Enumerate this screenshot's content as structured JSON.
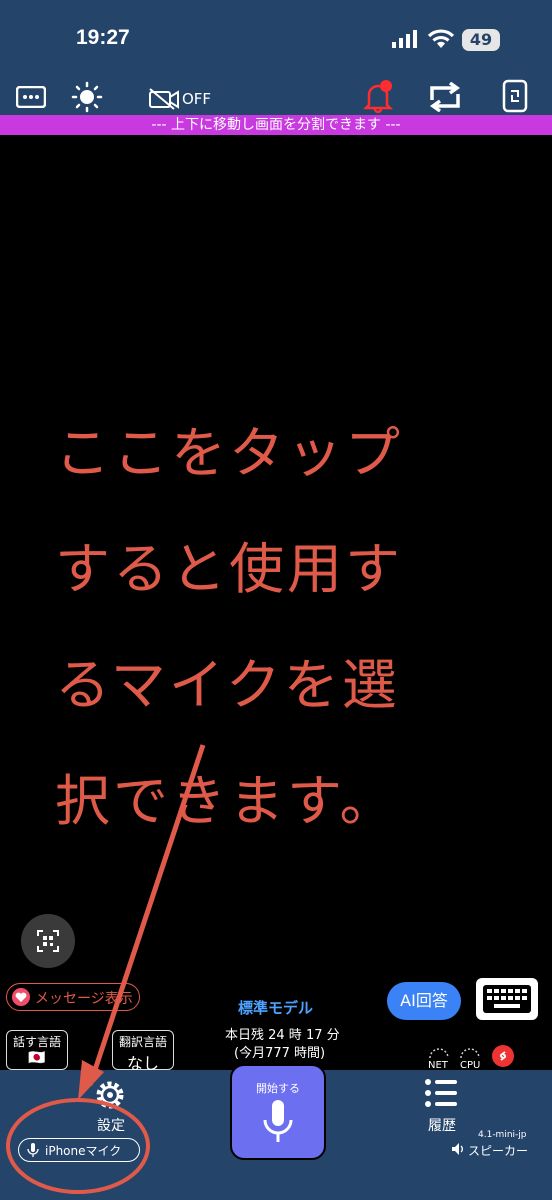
{
  "status": {
    "time": "19:27",
    "battery": "49"
  },
  "toolbar": {
    "camera_off_label": "OFF"
  },
  "divider": {
    "text": "--- 上下に移動し画面を分割できます ---"
  },
  "instruction": {
    "lines": [
      "ここをタップ",
      "すると使用す",
      "るマイクを選",
      "択できます。"
    ]
  },
  "controls": {
    "message_label": "メッセージ表示",
    "model_label": "標準モデル",
    "ai_button": "AI回答",
    "remaining_today": "本日残 24 時 17 分",
    "remaining_month": "(今月777 時間)",
    "speak_lang_title": "話す言語",
    "speak_lang_flag": "🇯🇵",
    "translate_lang_title": "翻訳言語",
    "translate_lang_value": "なし",
    "net_label": "NET",
    "cpu_label": "CPU"
  },
  "bottom": {
    "settings_label": "設定",
    "start_label": "開始する",
    "history_label": "履歴",
    "mic_chip_label": "iPhoneマイク",
    "version": "4.1-mini-jp",
    "speaker_label": "スピーカー"
  },
  "colors": {
    "bar_bg": "#25446a",
    "divider": "#c83ae0",
    "instruction_text": "#e05a4a",
    "annotation": "#e05a4a",
    "ai_button": "#3b82f6",
    "start_button": "#6b6ff0"
  }
}
